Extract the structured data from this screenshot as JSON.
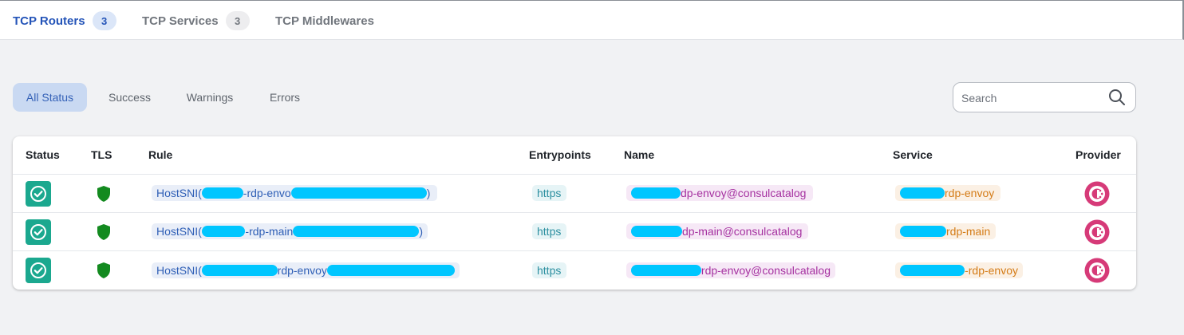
{
  "tabs": [
    {
      "label": "TCP Routers",
      "count": "3"
    },
    {
      "label": "TCP Services",
      "count": "3"
    },
    {
      "label": "TCP Middlewares"
    }
  ],
  "filters": [
    "All Status",
    "Success",
    "Warnings",
    "Errors"
  ],
  "search": {
    "placeholder": "Search"
  },
  "table": {
    "headers": [
      "Status",
      "TLS",
      "Rule",
      "Entrypoints",
      "Name",
      "Service",
      "Provider"
    ],
    "rows": [
      {
        "status": "success",
        "tls": "enabled",
        "rule_prefix": "HostSNI(",
        "rule_mid": "-rdp-envo",
        "rule_suffix": ")",
        "entrypoint": "https",
        "name_suffix": "dp-envoy@consulcatalog",
        "service_suffix": "rdp-envoy",
        "provider_icon": "consul-icon"
      },
      {
        "status": "success",
        "tls": "enabled",
        "rule_prefix": "HostSNI(",
        "rule_mid": "-rdp-main",
        "rule_suffix": ")",
        "entrypoint": "https",
        "name_suffix": "dp-main@consulcatalog",
        "service_suffix": "rdp-main",
        "provider_icon": "consul-icon"
      },
      {
        "status": "success",
        "tls": "enabled",
        "rule_prefix": "HostSNI(",
        "rule_mid": "rdp-envoy",
        "rule_suffix": ")",
        "entrypoint": "https",
        "name_suffix": "rdp-envoy@consulcatalog",
        "service_suffix": "-rdp-envoy",
        "provider_icon": "consul-icon"
      }
    ]
  },
  "colors": {
    "accent": "#2454b8",
    "success": "#1ba88f",
    "tls_shield": "#138a1f",
    "provider": "#d63a78",
    "redaction": "#00c6ff"
  }
}
